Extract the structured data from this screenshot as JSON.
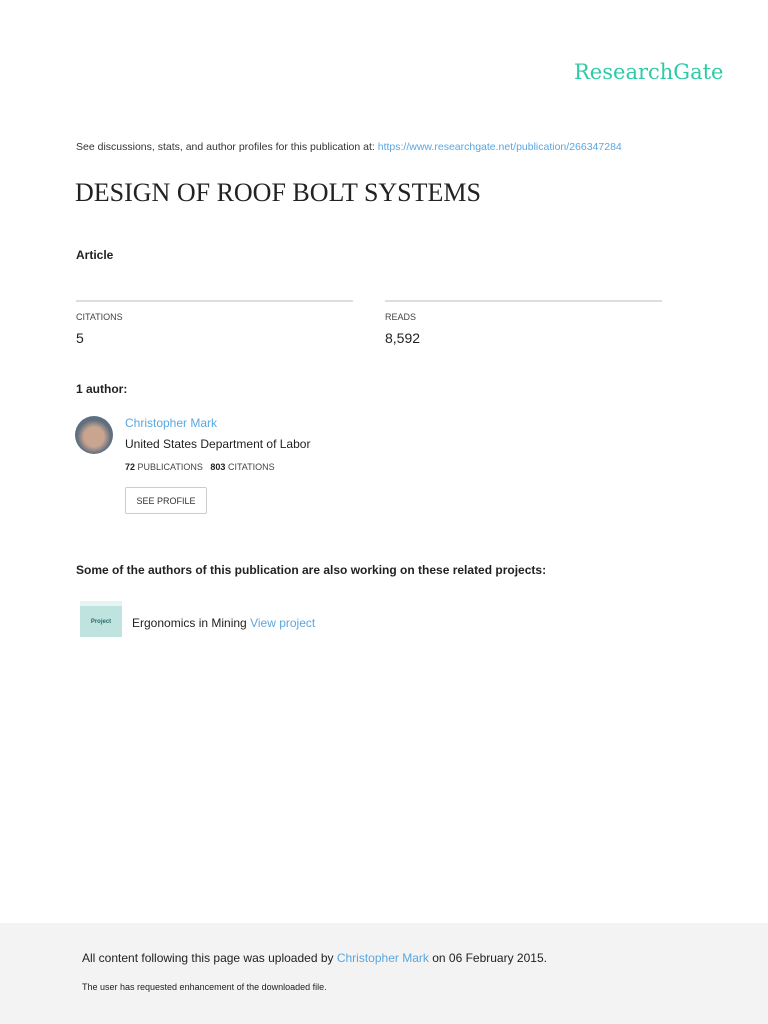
{
  "logo": "ResearchGate",
  "header": {
    "see_text": "See discussions, stats, and author profiles for this publication at: ",
    "url": "https://www.researchgate.net/publication/266347284"
  },
  "title": "DESIGN OF ROOF BOLT SYSTEMS",
  "type": "Article",
  "stats": {
    "citations_label": "CITATIONS",
    "citations": "5",
    "reads_label": "READS",
    "reads": "8,592"
  },
  "authors_heading": "1 author:",
  "author": {
    "name": "Christopher Mark",
    "institution": "United States Department of Labor",
    "publications": "72",
    "publications_label": "PUBLICATIONS",
    "citations": "803",
    "citations_label": "CITATIONS",
    "button": "SEE PROFILE"
  },
  "projects_heading": "Some of the authors of this publication are also working on these related projects:",
  "project": {
    "icon_label": "Project",
    "name": "Ergonomics in Mining",
    "link": "View project"
  },
  "footer": {
    "uploaded_prefix": "All content following this page was uploaded by ",
    "uploader": "Christopher Mark",
    "uploaded_suffix": " on 06 February 2015.",
    "requested": "The user has requested enhancement of the downloaded file."
  }
}
